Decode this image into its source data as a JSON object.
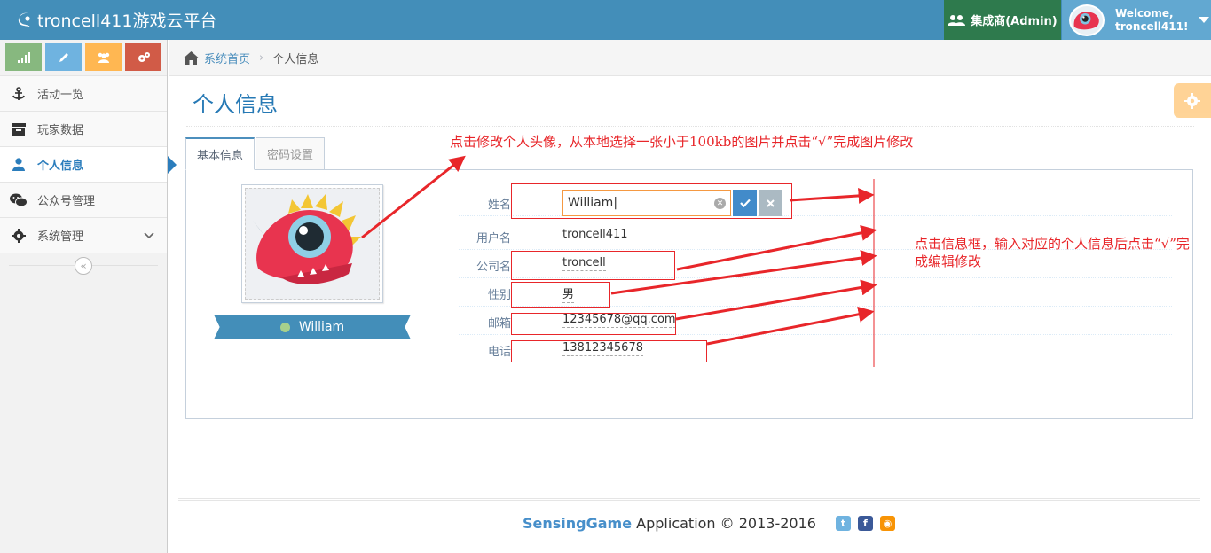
{
  "app": {
    "title": "troncell411游戏云平台"
  },
  "navbar": {
    "role_label": "集成商(Admin)",
    "welcome_line1": "Welcome,",
    "welcome_line2": "troncell411!"
  },
  "sidebar": {
    "items": [
      {
        "label": "活动一览",
        "icon": "anchor-icon"
      },
      {
        "label": "玩家数据",
        "icon": "archive-icon"
      },
      {
        "label": "个人信息",
        "icon": "user-icon",
        "active": true
      },
      {
        "label": "公众号管理",
        "icon": "wechat-icon"
      },
      {
        "label": "系统管理",
        "icon": "cogs-icon"
      }
    ]
  },
  "breadcrumb": {
    "home": "系统首页",
    "current": "个人信息"
  },
  "page": {
    "title": "个人信息"
  },
  "tabs": [
    {
      "label": "基本信息",
      "active": true
    },
    {
      "label": "密码设置",
      "active": false
    }
  ],
  "profile": {
    "display_name": "William",
    "status_color": "#a7d08c",
    "rows": [
      {
        "label": "姓名",
        "value": "William"
      },
      {
        "label": "用户名",
        "value": "troncell411"
      },
      {
        "label": "公司名",
        "value": "troncell"
      },
      {
        "label": "性别",
        "value": "男"
      },
      {
        "label": "邮箱",
        "value": "12345678@qq.com"
      },
      {
        "label": "电话",
        "value": "13812345678"
      }
    ]
  },
  "annotations": {
    "avatar_tip": "点击修改个人头像，从本地选择一张小于100kb的图片并点击“√”完成图片修改",
    "info_tip_line1": "点击信息框，输入对应的个人信息后点击“√”完",
    "info_tip_line2": "成编辑修改",
    "color": "#e8262a"
  },
  "footer": {
    "brand": "SensingGame",
    "text": " Application © 2013-2016",
    "social": [
      "twitter-icon",
      "facebook-icon",
      "rss-icon"
    ]
  }
}
